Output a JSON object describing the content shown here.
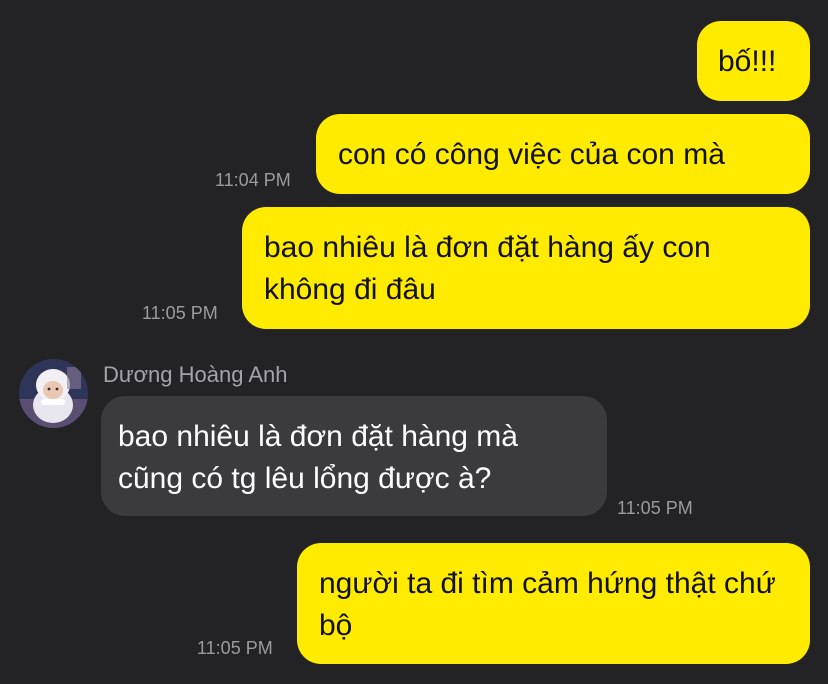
{
  "colors": {
    "background": "#232325",
    "outgoing_bubble": "#FFEB00",
    "incoming_bubble": "#3B3B3E",
    "timestamp": "#9B9B9F"
  },
  "messages": [
    {
      "direction": "out",
      "text": "bố!!!",
      "time": ""
    },
    {
      "direction": "out",
      "text": "con có công việc của con mà",
      "time": "11:04 PM"
    },
    {
      "direction": "out",
      "text": "bao nhiêu là đơn đặt hàng ấy con không đi đâu",
      "time": "11:05 PM"
    },
    {
      "direction": "in",
      "sender": "Dương Hoàng Anh",
      "avatar": "child-in-white-hat-avatar",
      "text": "bao nhiêu là đơn đặt hàng mà cũng có tg lêu lổng được à?",
      "time": "11:05 PM"
    },
    {
      "direction": "out",
      "text": "người ta đi tìm cảm hứng thật chứ bộ",
      "time": "11:05 PM"
    }
  ]
}
